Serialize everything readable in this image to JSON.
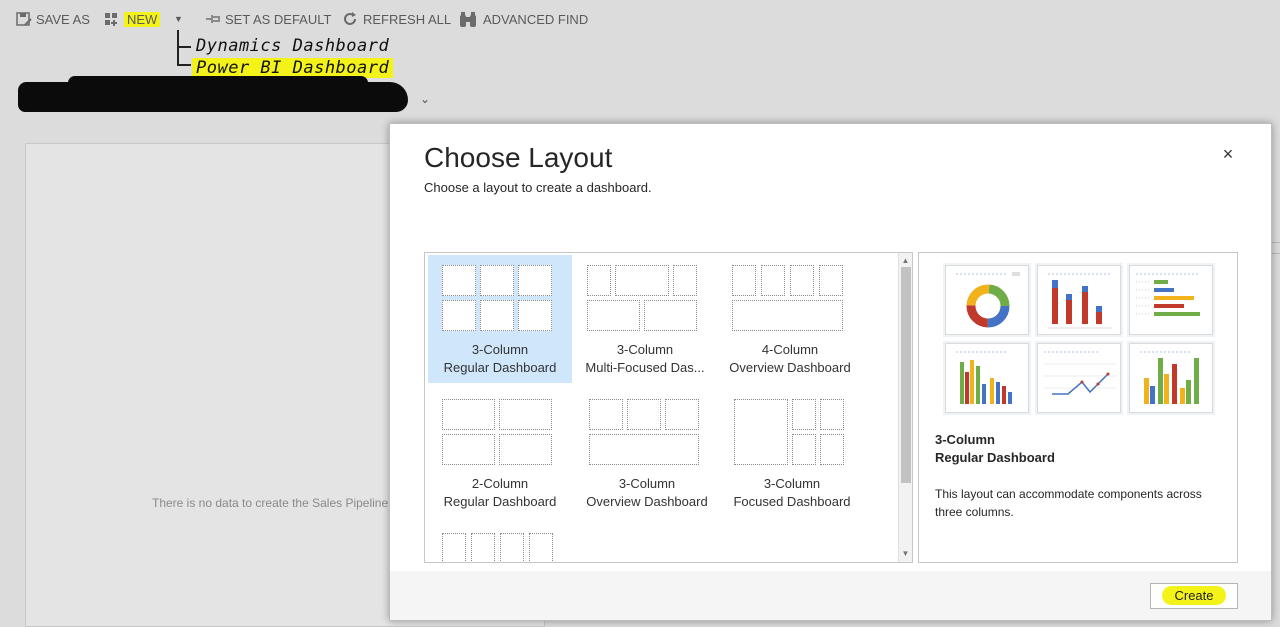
{
  "toolbar": {
    "save_as": "SAVE AS",
    "new": "NEW",
    "set_as_default": "SET AS DEFAULT",
    "refresh_all": "REFRESH ALL",
    "advanced_find": "ADVANCED FIND"
  },
  "annotations": {
    "line1": "Dynamics Dashboard",
    "line2": "Power BI Dashboard"
  },
  "background": {
    "empty_message": "There is no data to create the Sales Pipeline"
  },
  "dialog": {
    "title": "Choose Layout",
    "subtitle": "Choose a layout to create a dashboard.",
    "close": "×",
    "layouts": [
      {
        "line1": "3-Column",
        "line2": "Regular Dashboard",
        "selected": true
      },
      {
        "line1": "3-Column",
        "line2": "Multi-Focused Das...",
        "selected": false
      },
      {
        "line1": "4-Column",
        "line2": "Overview Dashboard",
        "selected": false
      },
      {
        "line1": "2-Column",
        "line2": "Regular Dashboard",
        "selected": false
      },
      {
        "line1": "3-Column",
        "line2": "Overview Dashboard",
        "selected": false
      },
      {
        "line1": "3-Column",
        "line2": "Focused Dashboard",
        "selected": false
      }
    ],
    "preview": {
      "title_line1": "3-Column",
      "title_line2": "Regular Dashboard",
      "description": "This layout can accommodate components across three columns."
    },
    "create_button": "Create"
  },
  "colors": {
    "highlight": "#f3f31a",
    "selected_tile": "#cfe6fb",
    "chart_blue": "#4472c4",
    "chart_red": "#c0392b",
    "chart_green": "#70ad47",
    "chart_yellow": "#f2b21b"
  }
}
